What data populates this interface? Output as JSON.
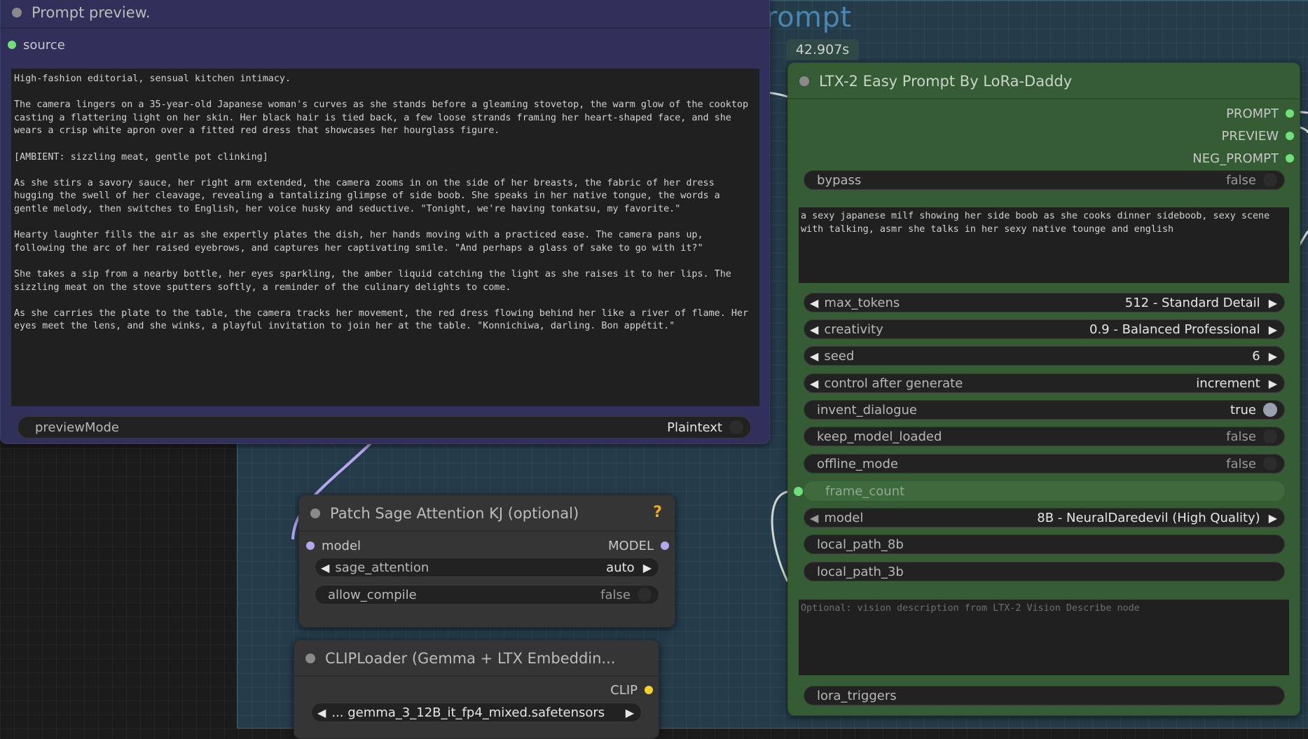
{
  "canvas": {
    "group_title": "rompt",
    "timer": "42.907s"
  },
  "preview_node": {
    "title": "Prompt preview.",
    "input_label": "source",
    "text": "High-fashion editorial, sensual kitchen intimacy.\n\nThe camera lingers on a 35-year-old Japanese woman's curves as she stands before a gleaming stovetop, the warm glow of the cooktop casting a flattering light on her skin. Her black hair is tied back, a few loose strands framing her heart-shaped face, and she wears a crisp white apron over a fitted red dress that showcases her hourglass figure.\n\n[AMBIENT: sizzling meat, gentle pot clinking]\n\nAs she stirs a savory sauce, her right arm extended, the camera zooms in on the side of her breasts, the fabric of her dress hugging the swell of her cleavage, revealing a tantalizing glimpse of side boob. She speaks in her native tongue, the words a gentle melody, then switches to English, her voice husky and seductive. \"Tonight, we're having tonkatsu, my favorite.\"\n\nHearty laughter fills the air as she expertly plates the dish, her hands moving with a practiced ease. The camera pans up, following the arc of her raised eyebrows, and captures her captivating smile. \"And perhaps a glass of sake to go with it?\"\n\nShe takes a sip from a nearby bottle, her eyes sparkling, the amber liquid catching the light as she raises it to her lips. The sizzling meat on the stove sputters softly, a reminder of the culinary delights to come.\n\nAs she carries the plate to the table, the camera tracks her movement, the red dress flowing behind her like a river of flame. Her eyes meet the lens, and she winks, a playful invitation to join her at the table. \"Konnichiwa, darling. Bon appétit.\"",
    "preview_mode": {
      "label": "previewMode",
      "value": "Plaintext"
    }
  },
  "easy_prompt_node": {
    "title": "LTX-2 Easy Prompt By LoRa-Daddy",
    "outputs": [
      "PROMPT",
      "PREVIEW",
      "NEG_PROMPT"
    ],
    "bypass": {
      "label": "bypass",
      "value": "false"
    },
    "prompt_text": "a sexy japanese milf showing her side boob as she cooks dinner sideboob, sexy scene with talking, asmr she talks in her sexy native tounge and english",
    "max_tokens": {
      "label": "max_tokens",
      "value": "512 - Standard Detail"
    },
    "creativity": {
      "label": "creativity",
      "value": "0.9 - Balanced Professional"
    },
    "seed": {
      "label": "seed",
      "value": "6"
    },
    "control_after_generate": {
      "label": "control after generate",
      "value": "increment"
    },
    "invent_dialogue": {
      "label": "invent_dialogue",
      "value": "true"
    },
    "keep_model_loaded": {
      "label": "keep_model_loaded",
      "value": "false"
    },
    "offline_mode": {
      "label": "offline_mode",
      "value": "false"
    },
    "frame_count": {
      "label": "frame_count"
    },
    "model": {
      "label": "model",
      "value": "8B - NeuralDaredevil (High Quality)"
    },
    "local_path_8b": {
      "label": "local_path_8b"
    },
    "local_path_3b": {
      "label": "local_path_3b"
    },
    "vision_placeholder": "Optional: vision description from LTX-2 Vision Describe node",
    "lora_triggers": {
      "label": "lora_triggers"
    }
  },
  "sage_node": {
    "title": "Patch Sage Attention KJ (optional)",
    "badge": "?",
    "input_label": "model",
    "output_label": "MODEL",
    "sage_attention": {
      "label": "sage_attention",
      "value": "auto"
    },
    "allow_compile": {
      "label": "allow_compile",
      "value": "false"
    }
  },
  "clip_node": {
    "title": "CLIPLoader (Gemma + LTX Embeddin...",
    "output_label": "CLIP",
    "clip_name": {
      "value": "... gemma_3_12B_it_fp4_mixed.safetensors"
    }
  },
  "colors": {
    "preview_node_bg": "#30305a",
    "easy_prompt_bg": "#355c34",
    "slot_green": "#6fe07a",
    "slot_purple": "#b6a6f0",
    "slot_yellow": "#f6d22c",
    "link_purple": "#b6a6f0",
    "group_blue": "#243b4a"
  },
  "icons": {
    "left_arrow": "◀",
    "right_arrow": "▶"
  }
}
